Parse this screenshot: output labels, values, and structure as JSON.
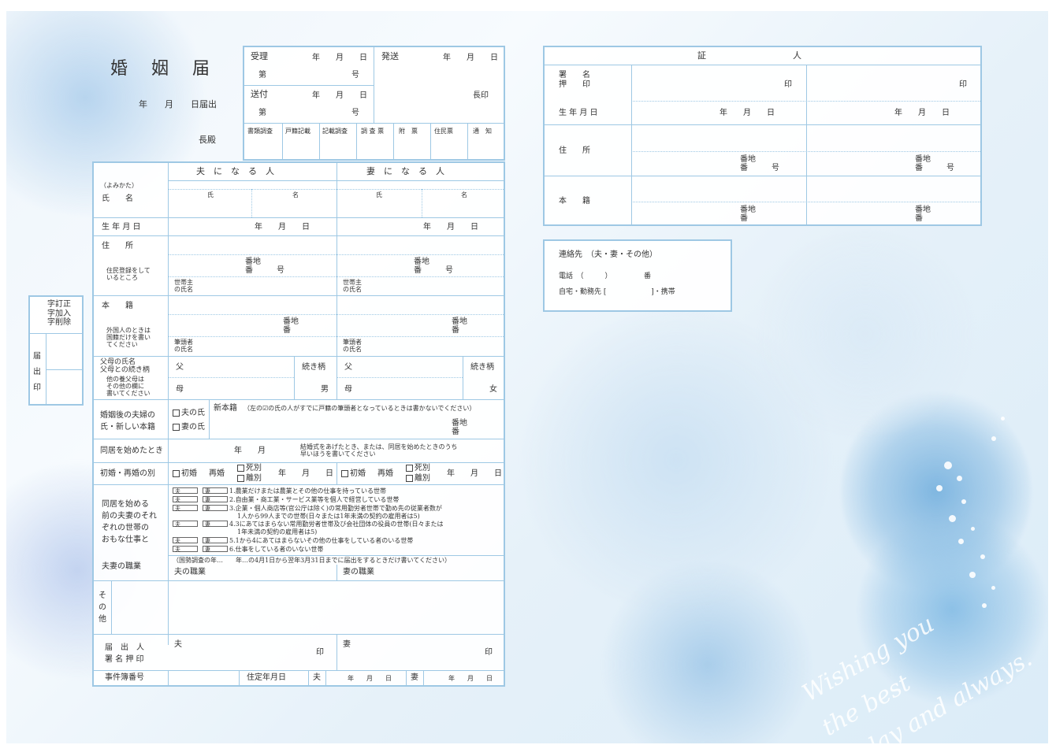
{
  "form": {
    "title": "婚　姻　届",
    "date_filed": "年　　月　　日届出",
    "addressee": "長殿"
  },
  "office": {
    "received": "受理",
    "received_date": "年　　月　　日",
    "dai": "第",
    "go": "号",
    "sent": "発送",
    "sent_date": "年　　月　　日",
    "forwarded": "送付",
    "forwarded_date": "年　　月　　日",
    "cho_in": "長印",
    "checks": [
      "書類調査",
      "戸籍記載",
      "記載調査",
      "調 査 票",
      "附　票",
      "住民票",
      "通　知"
    ]
  },
  "main": {
    "husband_header": "夫　に　な　る　人",
    "wife_header": "妻　に　な　る　人",
    "yomikata": "（よみかた）",
    "name_label": "氏　　名",
    "family_name": "氏",
    "given_name": "名",
    "birth_label": "生 年 月 日",
    "ymd": "年　　月　　日",
    "address_label": "住　　所",
    "address_note": "住民登録をして\nいるところ",
    "banchi": "番地",
    "ban_go": "番　　　号",
    "setai": "世帯主\nの氏名",
    "honseki_label": "本　　籍",
    "honseki_note": "外国人のときは\n国籍だけを書い\nてください",
    "ban": "番",
    "hittosha": "筆頭者\nの氏名",
    "parents_label": "父母の氏名\n父母との続き柄",
    "parents_note": "他の養父母は\nその他の欄に\n書いてください",
    "father": "父",
    "mother": "母",
    "relation": "続き柄",
    "male": "男",
    "female": "女",
    "new_surname_label": "婚姻後の夫婦の\n氏・新しい本籍",
    "husband_surname": "夫の氏",
    "wife_surname": "妻の氏",
    "new_honseki": "新本籍",
    "new_honseki_note": "（左の☑の氏の人がすでに戸籍の筆頭者となっているときは書かないでください）",
    "cohabit_label": "同居を始めたとき",
    "ym": "年　　月",
    "cohabit_note": "結婚式をあげたとき、または、同居を始めたときのうち\n早いほうを書いてください",
    "marriage_type_label": "初婚・再婚の別",
    "first": "初婚",
    "re": "再婚",
    "death": "死別",
    "divorce": "離別",
    "work_label": "同居を始める\n前の夫妻のそれ\nぞれの世帯の\nおもな仕事と",
    "occupation_label": "夫妻の職業",
    "tag_h": "夫",
    "tag_w": "妻",
    "work_items": [
      "1.農業だけまたは農業とその他の仕事を持っている世帯",
      "2.自由業・商工業・サービス業等を個人で経営している世帯",
      "3.企業・個人商店等(官公庁は除く)の常用勤労者世帯で勤め先の従業者数が",
      "1人から99人までの世帯(日々または1年未満の契約の雇用者は5)",
      "4.3にあてはまらない常用勤労者世帯及び会社団体の役員の世帯(日々または",
      "1年未満の契約の雇用者は5)",
      "5.1から4にあてはまらないその他の仕事をしている者のいる世帯",
      "6.仕事をしている者のいない世帯"
    ],
    "census_note": "（国勢調査の年…　　年…の4月1日から翌年3月31日までに届出をするときだけ書いてください）",
    "husband_job": "夫の職業",
    "wife_job": "妻の職業",
    "other": "そ\nの\n他",
    "signer_label": "届　出　人\n署 名 押 印",
    "husband": "夫",
    "wife": "妻",
    "seal": "印",
    "case_no": "事件簿番号",
    "residence_date": "住定年月日",
    "hymd": "年　　月　　日"
  },
  "correction": {
    "label": "字訂正\n字加入\n字削除",
    "seal_label": "届\n出\n印"
  },
  "witness": {
    "header": "証　　　　　　　　　　人",
    "sign_label": "署　　名\n押　　印",
    "seal": "印",
    "birth": "生 年 月 日",
    "ymd": "年　　月　　日",
    "address": "住　　所",
    "banchi": "番地",
    "ban_go": "番　　　号",
    "honseki": "本　　籍",
    "ban": "番"
  },
  "contact": {
    "label": "連絡先　（夫・妻・その他）",
    "phone": "電話　（　　　）　　　　　番",
    "where": "自宅・勤務先 [　　　　　　 ]・携帯"
  },
  "decor": {
    "script_text": "Wishing you\nthe best\ntoday and always."
  }
}
